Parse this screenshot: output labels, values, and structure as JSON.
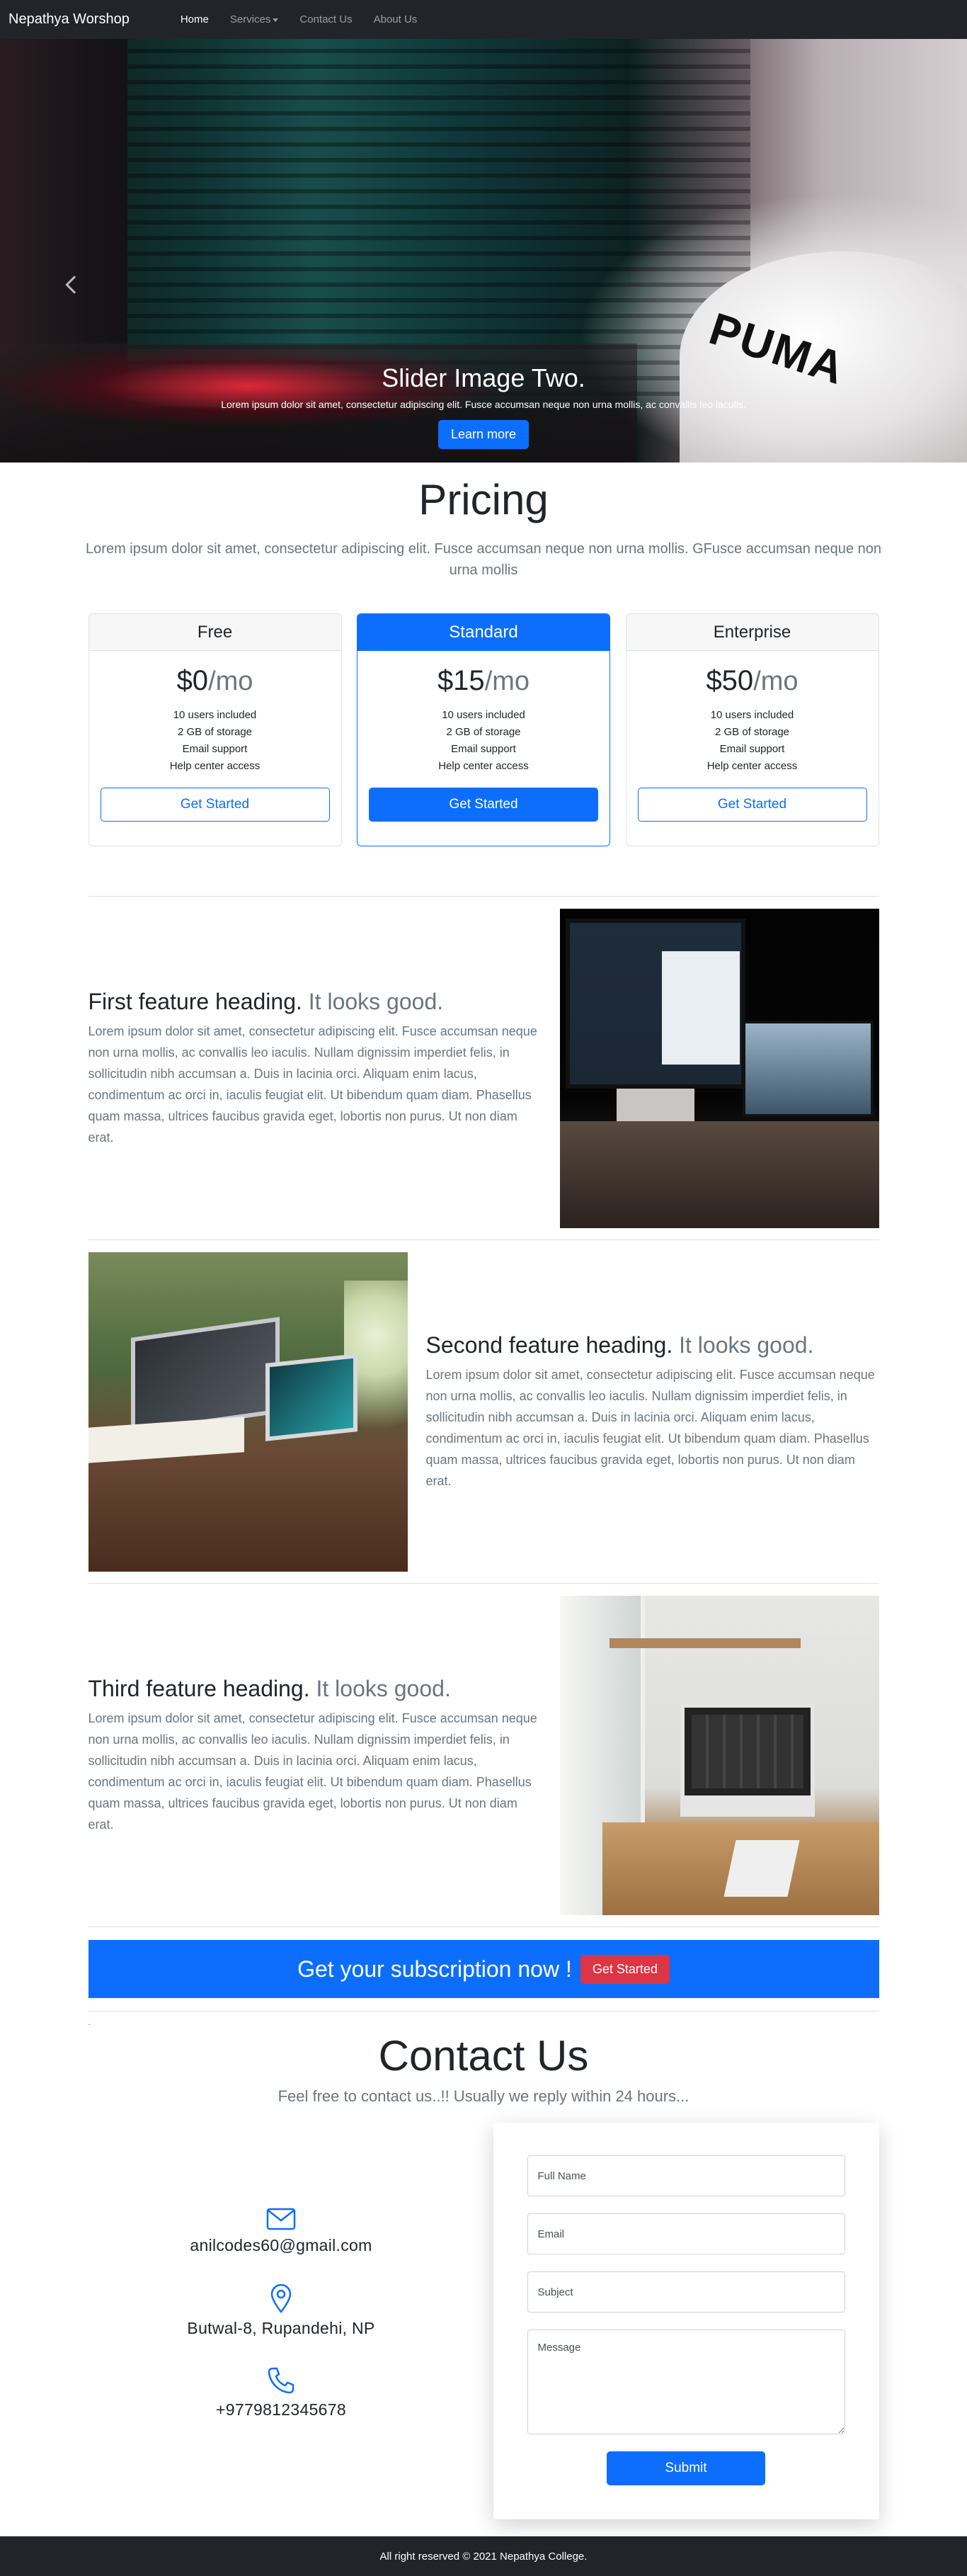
{
  "nav": {
    "brand": "Nepathya Worshop",
    "items": [
      {
        "label": "Home"
      },
      {
        "label": "Services"
      },
      {
        "label": "Contact Us"
      },
      {
        "label": "About Us"
      }
    ]
  },
  "hero": {
    "title": "Slider Image Two.",
    "text": "Lorem ipsum dolor sit amet, consectetur adipiscing elit. Fusce accumsan neque non urna mollis, ac convallis leo iaculis.",
    "button": "Learn more",
    "active_slide": 2,
    "slide_count": 3
  },
  "pricing": {
    "title": "Pricing",
    "lead": "Lorem ipsum dolor sit amet, consectetur adipiscing elit. Fusce accumsan neque non urna mollis. GFusce accumsan neque non urna mollis",
    "plans": [
      {
        "name": "Free",
        "price": "$0",
        "per": "/mo",
        "features": [
          "10 users included",
          "2 GB of storage",
          "Email support",
          "Help center access"
        ],
        "button": "Get Started"
      },
      {
        "name": "Standard",
        "price": "$15",
        "per": "/mo",
        "features": [
          "10 users included",
          "2 GB of storage",
          "Email support",
          "Help center access"
        ],
        "button": "Get Started"
      },
      {
        "name": "Enterprise",
        "price": "$50",
        "per": "/mo",
        "features": [
          "10 users included",
          "2 GB of storage",
          "Email support",
          "Help center access"
        ],
        "button": "Get Started"
      }
    ]
  },
  "features": [
    {
      "heading": "First feature heading.",
      "muted": "It looks good.",
      "text": "Lorem ipsum dolor sit amet, consectetur adipiscing elit. Fusce accumsan neque non urna mollis, ac convallis leo iaculis. Nullam dignissim imperdiet felis, in sollicitudin nibh accumsan a. Duis in lacinia orci. Aliquam enim lacus, condimentum ac orci in, iaculis feugiat elit. Ut bibendum quam diam. Phasellus quam massa, ultrices faucibus gravida eget, lobortis non purus. Ut non diam erat."
    },
    {
      "heading": "Second feature heading.",
      "muted": "It looks good.",
      "text": "Lorem ipsum dolor sit amet, consectetur adipiscing elit. Fusce accumsan neque non urna mollis, ac convallis leo iaculis. Nullam dignissim imperdiet felis, in sollicitudin nibh accumsan a. Duis in lacinia orci. Aliquam enim lacus, condimentum ac orci in, iaculis feugiat elit. Ut bibendum quam diam. Phasellus quam massa, ultrices faucibus gravida eget, lobortis non purus. Ut non diam erat."
    },
    {
      "heading": "Third feature heading.",
      "muted": "It looks good.",
      "text": "Lorem ipsum dolor sit amet, consectetur adipiscing elit. Fusce accumsan neque non urna mollis, ac convallis leo iaculis. Nullam dignissim imperdiet felis, in sollicitudin nibh accumsan a. Duis in lacinia orci. Aliquam enim lacus, condimentum ac orci in, iaculis feugiat elit. Ut bibendum quam diam. Phasellus quam massa, ultrices faucibus gravida eget, lobortis non purus. Ut non diam erat."
    }
  ],
  "subscribe": {
    "text": "Get your subscription now !",
    "button": "Get Started",
    "dot": "."
  },
  "contact": {
    "title": "Contact Us",
    "lead": "Feel free to contact us..!! Usually we reply within 24 hours...",
    "email": "anilcodes60@gmail.com",
    "address": "Butwal-8, Rupandehi, NP",
    "phone": "+9779812345678",
    "icons": [
      "envelope-icon",
      "map-pin-icon",
      "phone-icon"
    ],
    "form": {
      "name_placeholder": "Full Name",
      "email_placeholder": "Email",
      "subject_placeholder": "Subject",
      "message_placeholder": "Message",
      "submit": "Submit"
    }
  },
  "footer": {
    "text": "All right reserved © 2021 Nepathya College."
  },
  "colors": {
    "primary": "#0d6efd",
    "danger": "#dc3545",
    "dark": "#212529",
    "muted": "#6c757d"
  }
}
